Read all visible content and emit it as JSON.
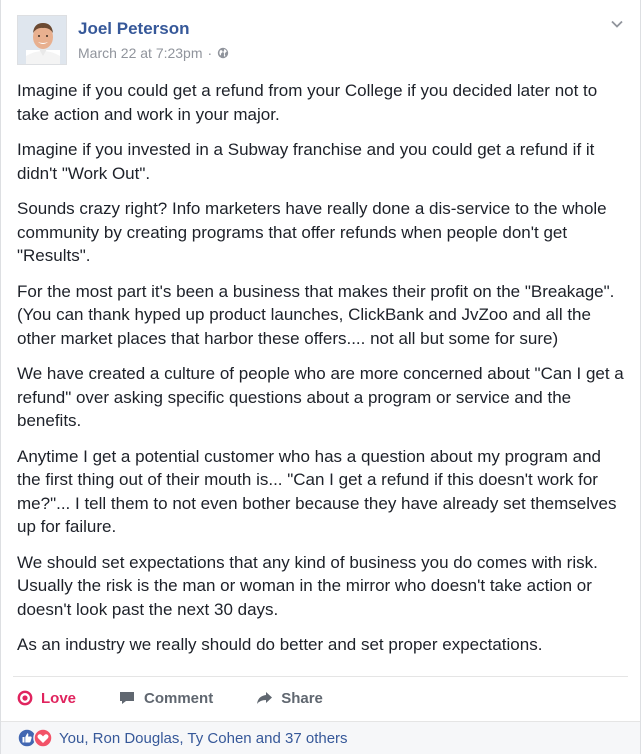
{
  "post": {
    "author": "Joel Peterson",
    "timestamp": "March 22 at 7:23pm",
    "separator": "·",
    "privacy_icon": "globe-icon",
    "menu_icon": "chevron-down-icon",
    "paragraphs": [
      "Imagine if you could get a refund from your College if you decided later not to take action and work in your major.",
      "Imagine if you invested in a Subway franchise and you could get a refund if it didn't \"Work Out\".",
      "Sounds crazy right? Info marketers have really done a dis-service to the whole community by creating programs that offer refunds when people don't get \"Results\".",
      "For the most part it's been a business that makes their profit on the \"Breakage\". (You can thank hyped up product launches, ClickBank and JvZoo and all the other market places that harbor these offers.... not all but some for sure)",
      "We have created a culture of people who are more concerned about \"Can I get a refund\" over asking specific questions about a program or service and the benefits.",
      "Anytime I get a potential customer who has a question about my program and the first thing out of their mouth is... \"Can I get a refund if this doesn't work for me?\"... I tell them to not even bother because they have already set themselves up for failure.",
      "We should set expectations that any kind of business you do comes with risk. Usually the risk is the man or woman in the mirror who doesn't take action or doesn't look past the next 30 days.",
      "As an industry we really should do better and set proper expectations."
    ]
  },
  "actions": {
    "love_label": "Love",
    "comment_label": "Comment",
    "share_label": "Share"
  },
  "reactions": {
    "summary": "You, Ron Douglas, Ty Cohen and 37 others",
    "icons": [
      "like-reaction-icon",
      "love-reaction-icon"
    ]
  },
  "colors": {
    "author_link": "#365899",
    "love_active": "#e0245e",
    "meta_gray": "#90949c",
    "action_gray": "#606770",
    "like_blue": "#4267b2"
  }
}
